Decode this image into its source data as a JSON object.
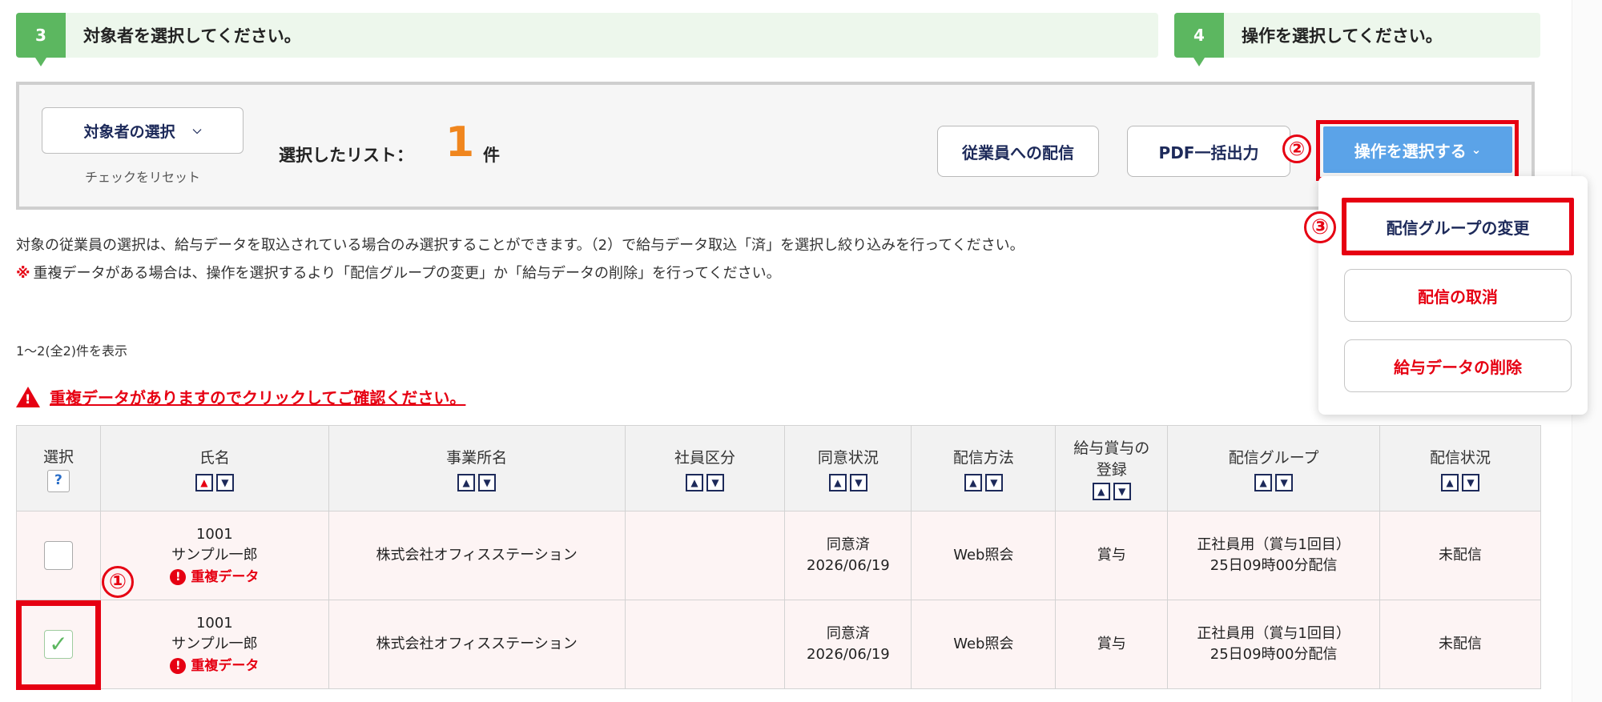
{
  "steps": {
    "step3": {
      "num": "3",
      "text": "対象者を選択してください。"
    },
    "step4": {
      "num": "4",
      "text": "操作を選択してください。"
    }
  },
  "selection": {
    "button_label": "対象者の選択",
    "reset_link": "チェックをリセット",
    "list_label": "選択したリスト：",
    "count": "1",
    "unit": "件"
  },
  "actions": {
    "distribute": "従業員への配信",
    "pdf_export": "PDF一括出力",
    "operation": "操作を選択する",
    "menu": {
      "change_group": "配信グループの変更",
      "cancel": "配信の取消",
      "delete": "給与データの削除"
    }
  },
  "annotations": {
    "one": "①",
    "two": "②",
    "three": "③"
  },
  "notes": {
    "line1": "対象の従業員の選択は、給与データを取込されている場合のみ選択することができます。（2）で給与データ取込「済」を選択し絞り込みを行ってください。",
    "line2_mark": "※",
    "line2": "重複データがある場合は、操作を選択するより「配信グループの変更」か「給与データの削除」を行ってください。"
  },
  "count_text": "1〜2(全2)件を表示",
  "duplicate_warning": "重複データがありますのでクリックしてご確認ください。",
  "table": {
    "headers": {
      "select": "選択",
      "help": "?",
      "name": "氏名",
      "office": "事業所名",
      "employee_type": "社員区分",
      "consent": "同意状況",
      "method": "配信方法",
      "register_l1": "給与賞与の",
      "register_l2": "登録",
      "group": "配信グループ",
      "status": "配信状況"
    },
    "rows": [
      {
        "checked": false,
        "id": "1001",
        "name": "サンプル一郎",
        "dup": "重複データ",
        "office": "株式会社オフィスステーション",
        "employee_type": "",
        "consent": "同意済",
        "consent_date": "2026/06/19",
        "method": "Web照会",
        "register": "賞与",
        "group": "正社員用（賞与1回目）",
        "group_time": "25日09時00分配信",
        "status": "未配信"
      },
      {
        "checked": true,
        "id": "1001",
        "name": "サンプル一郎",
        "dup": "重複データ",
        "office": "株式会社オフィスステーション",
        "employee_type": "",
        "consent": "同意済",
        "consent_date": "2026/06/19",
        "method": "Web照会",
        "register": "賞与",
        "group": "正社員用（賞与1回目）",
        "group_time": "25日09時00分配信",
        "status": "未配信"
      }
    ]
  },
  "colors": {
    "accent_green": "#5cb760",
    "highlight_red": "#e60012",
    "primary_blue": "#5ba3e8",
    "count_orange": "#f0861e",
    "navy": "#1d2a5a"
  }
}
